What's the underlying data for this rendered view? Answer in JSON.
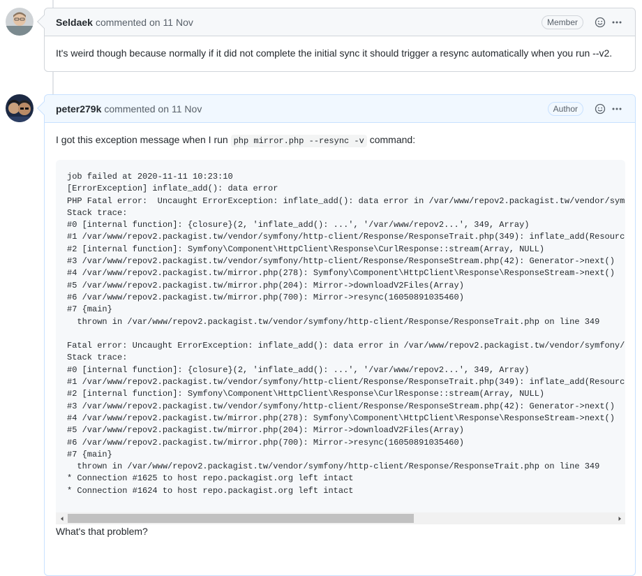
{
  "comments": [
    {
      "username": "Seldaek",
      "action": "commented on",
      "date": "11 Nov",
      "role": "Member",
      "body": "It's weird though because normally if it did not complete the initial sync it should trigger a resync automatically when you run --v2."
    },
    {
      "username": "peter279k",
      "action": "commented on",
      "date": "11 Nov",
      "role": "Author",
      "intro_before": "I got this exception message when I run",
      "intro_code": "php mirror.php --resync -v",
      "intro_after": "command:",
      "code_block": "job failed at 2020-11-11 10:23:10\n[ErrorException] inflate_add(): data error\nPHP Fatal error:  Uncaught ErrorException: inflate_add(): data error in /var/www/repov2.packagist.tw/vendor/symfony/http-client/Response/ResponseTrait.php:349\nStack trace:\n#0 [internal function]: {closure}(2, 'inflate_add(): ...', '/var/www/repov2...', 349, Array)\n#1 /var/www/repov2.packagist.tw/vendor/symfony/http-client/Response/ResponseTrait.php(349): inflate_add(Resource id #1234, '...', 2)\n#2 [internal function]: Symfony\\Component\\HttpClient\\Response\\CurlResponse::stream(Array, NULL)\n#3 /var/www/repov2.packagist.tw/vendor/symfony/http-client/Response/ResponseStream.php(42): Generator->next()\n#4 /var/www/repov2.packagist.tw/mirror.php(278): Symfony\\Component\\HttpClient\\Response\\ResponseStream->next()\n#5 /var/www/repov2.packagist.tw/mirror.php(204): Mirror->downloadV2Files(Array)\n#6 /var/www/repov2.packagist.tw/mirror.php(700): Mirror->resync(16050891035460)\n#7 {main}\n  thrown in /var/www/repov2.packagist.tw/vendor/symfony/http-client/Response/ResponseTrait.php on line 349\n\nFatal error: Uncaught ErrorException: inflate_add(): data error in /var/www/repov2.packagist.tw/vendor/symfony/http-client/Response/ResponseTrait.php:349\nStack trace:\n#0 [internal function]: {closure}(2, 'inflate_add(): ...', '/var/www/repov2...', 349, Array)\n#1 /var/www/repov2.packagist.tw/vendor/symfony/http-client/Response/ResponseTrait.php(349): inflate_add(Resource id #1234, '...', 2)\n#2 [internal function]: Symfony\\Component\\HttpClient\\Response\\CurlResponse::stream(Array, NULL)\n#3 /var/www/repov2.packagist.tw/vendor/symfony/http-client/Response/ResponseStream.php(42): Generator->next()\n#4 /var/www/repov2.packagist.tw/mirror.php(278): Symfony\\Component\\HttpClient\\Response\\ResponseStream->next()\n#5 /var/www/repov2.packagist.tw/mirror.php(204): Mirror->downloadV2Files(Array)\n#6 /var/www/repov2.packagist.tw/mirror.php(700): Mirror->resync(16050891035460)\n#7 {main}\n  thrown in /var/www/repov2.packagist.tw/vendor/symfony/http-client/Response/ResponseTrait.php on line 349\n* Connection #1625 to host repo.packagist.org left intact\n* Connection #1624 to host repo.packagist.org left intact",
      "scrollbar": {
        "left_arrow": "‹",
        "right_arrow": "›"
      },
      "outro": "What's that problem?"
    }
  ],
  "icons": {
    "reaction": "smiley-icon",
    "menu": "kebab-horizontal-icon"
  },
  "colors": {
    "author_header_bg": "#f1f8ff",
    "author_border": "#c8e1ff",
    "member_header_bg": "#f6f8fa",
    "border": "#d1d5da"
  }
}
